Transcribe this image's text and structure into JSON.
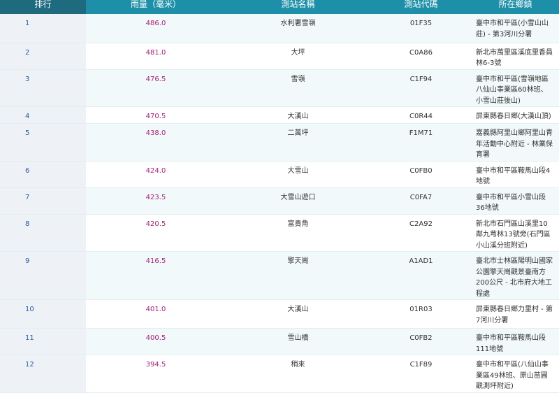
{
  "table": {
    "headers": {
      "rank": "排行",
      "rainfall": "雨量（毫米）",
      "station_name": "測站名稱",
      "station_code": "測站代碼",
      "location": "所在鄉鎮"
    },
    "rows": [
      {
        "rank": "1",
        "rainfall": "486.0",
        "name": "水利署雪嶺",
        "code": "01F35",
        "location": "臺中市和平區(小雪山山莊) - 第3河川分署"
      },
      {
        "rank": "2",
        "rainfall": "481.0",
        "name": "大坪",
        "code": "C0A86",
        "location": "新北市萬里區溪底里香員林6-3號"
      },
      {
        "rank": "3",
        "rainfall": "476.5",
        "name": "雪嶺",
        "code": "C1F94",
        "location": "臺中市和平區(雪嶺地區八仙山事業區60林班、小雪山莊後山)"
      },
      {
        "rank": "4",
        "rainfall": "470.5",
        "name": "大漢山",
        "code": "C0R44",
        "location": "屏東縣春日鄉(大漢山頂)"
      },
      {
        "rank": "5",
        "rainfall": "438.0",
        "name": "二萬坪",
        "code": "F1M71",
        "location": "嘉義縣阿里山鄉阿里山青年活動中心附近 - 林業保育署"
      },
      {
        "rank": "6",
        "rainfall": "424.0",
        "name": "大雪山",
        "code": "C0FB0",
        "location": "臺中市和平區鞍馬山段4地號"
      },
      {
        "rank": "7",
        "rainfall": "423.5",
        "name": "大雪山遊口",
        "code": "C0FA7",
        "location": "臺中市和平區小雪山段36地號"
      },
      {
        "rank": "8",
        "rainfall": "420.5",
        "name": "富貴角",
        "code": "C2A92",
        "location": "新北市石門區山溪里10鄰九芎林13號旁(石門區小山溪分班附近)"
      },
      {
        "rank": "9",
        "rainfall": "416.5",
        "name": "擎天崗",
        "code": "A1AD1",
        "location": "臺北市士林區陽明山國家公園擎天崗觀景臺南方200公尺 - 北市府大地工程處"
      },
      {
        "rank": "10",
        "rainfall": "401.0",
        "name": "大漢山",
        "code": "01R03",
        "location": "屏東縣春日鄉力里村 - 第7河川分署"
      },
      {
        "rank": "11",
        "rainfall": "400.5",
        "name": "雪山橋",
        "code": "C0FB2",
        "location": "臺中市和平區鞍馬山段111地號"
      },
      {
        "rank": "12",
        "rainfall": "394.5",
        "name": "稍來",
        "code": "C1F89",
        "location": "臺中市和平區(八仙山事業區49林班、原山苗圃觀測坪附近)"
      }
    ]
  }
}
